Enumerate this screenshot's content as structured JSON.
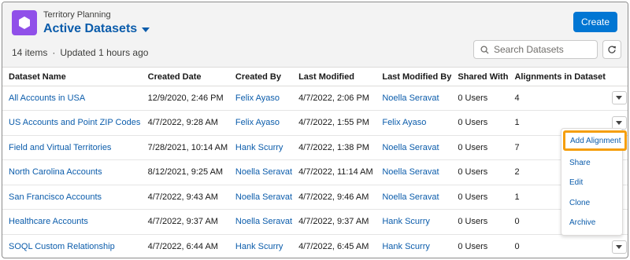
{
  "header": {
    "eyebrow": "Territory Planning",
    "title": "Active Datasets",
    "item_count": "14 items",
    "separator": "·",
    "updated": "Updated 1 hours ago",
    "create_label": "Create",
    "search_placeholder": "Search Datasets",
    "app_icon": "hexagon-icon",
    "accent_color": "#0176d3",
    "link_color": "#0b5cab",
    "icon_color": "#9050e9"
  },
  "table": {
    "columns": [
      "Dataset Name",
      "Created Date",
      "Created By",
      "Last Modified",
      "Last Modified By",
      "Shared With",
      "Alignments in Dataset"
    ],
    "rows": [
      {
        "name": "All Accounts in USA",
        "created_date": "12/9/2020, 2:46 PM",
        "created_by": "Felix Ayaso",
        "last_modified": "4/7/2022, 2:06 PM",
        "last_modified_by": "Noella Seravat",
        "shared_with": "0 Users",
        "alignments": "4"
      },
      {
        "name": "US Accounts and Point ZIP Codes",
        "created_date": "4/7/2022, 9:28 AM",
        "created_by": "Felix Ayaso",
        "last_modified": "4/7/2022, 1:55 PM",
        "last_modified_by": "Felix Ayaso",
        "shared_with": "0 Users",
        "alignments": "1"
      },
      {
        "name": "Field and Virtual Territories",
        "created_date": "7/28/2021, 10:14 AM",
        "created_by": "Hank Scurry",
        "last_modified": "4/7/2022, 1:38 PM",
        "last_modified_by": "Noella Seravat",
        "shared_with": "0 Users",
        "alignments": "7"
      },
      {
        "name": "North Carolina Accounts",
        "created_date": "8/12/2021, 9:25 AM",
        "created_by": "Noella Seravat",
        "last_modified": "4/7/2022, 11:14 AM",
        "last_modified_by": "Noella Seravat",
        "shared_with": "0 Users",
        "alignments": "2"
      },
      {
        "name": "San Francisco Accounts",
        "created_date": "4/7/2022, 9:43 AM",
        "created_by": "Noella Seravat",
        "last_modified": "4/7/2022, 9:46 AM",
        "last_modified_by": "Noella Seravat",
        "shared_with": "0 Users",
        "alignments": "1"
      },
      {
        "name": "Healthcare Accounts",
        "created_date": "4/7/2022, 9:37 AM",
        "created_by": "Noella Seravat",
        "last_modified": "4/7/2022, 9:37 AM",
        "last_modified_by": "Hank Scurry",
        "shared_with": "0 Users",
        "alignments": "0"
      },
      {
        "name": "SOQL Custom Relationship",
        "created_date": "4/7/2022, 6:44 AM",
        "created_by": "Hank Scurry",
        "last_modified": "4/7/2022, 6:45 AM",
        "last_modified_by": "Hank Scurry",
        "shared_with": "0 Users",
        "alignments": "0"
      }
    ]
  },
  "row_menu": {
    "items": [
      "Add Alignment",
      "Share",
      "Edit",
      "Clone",
      "Archive"
    ],
    "highlight_color": "#f59e0b"
  }
}
